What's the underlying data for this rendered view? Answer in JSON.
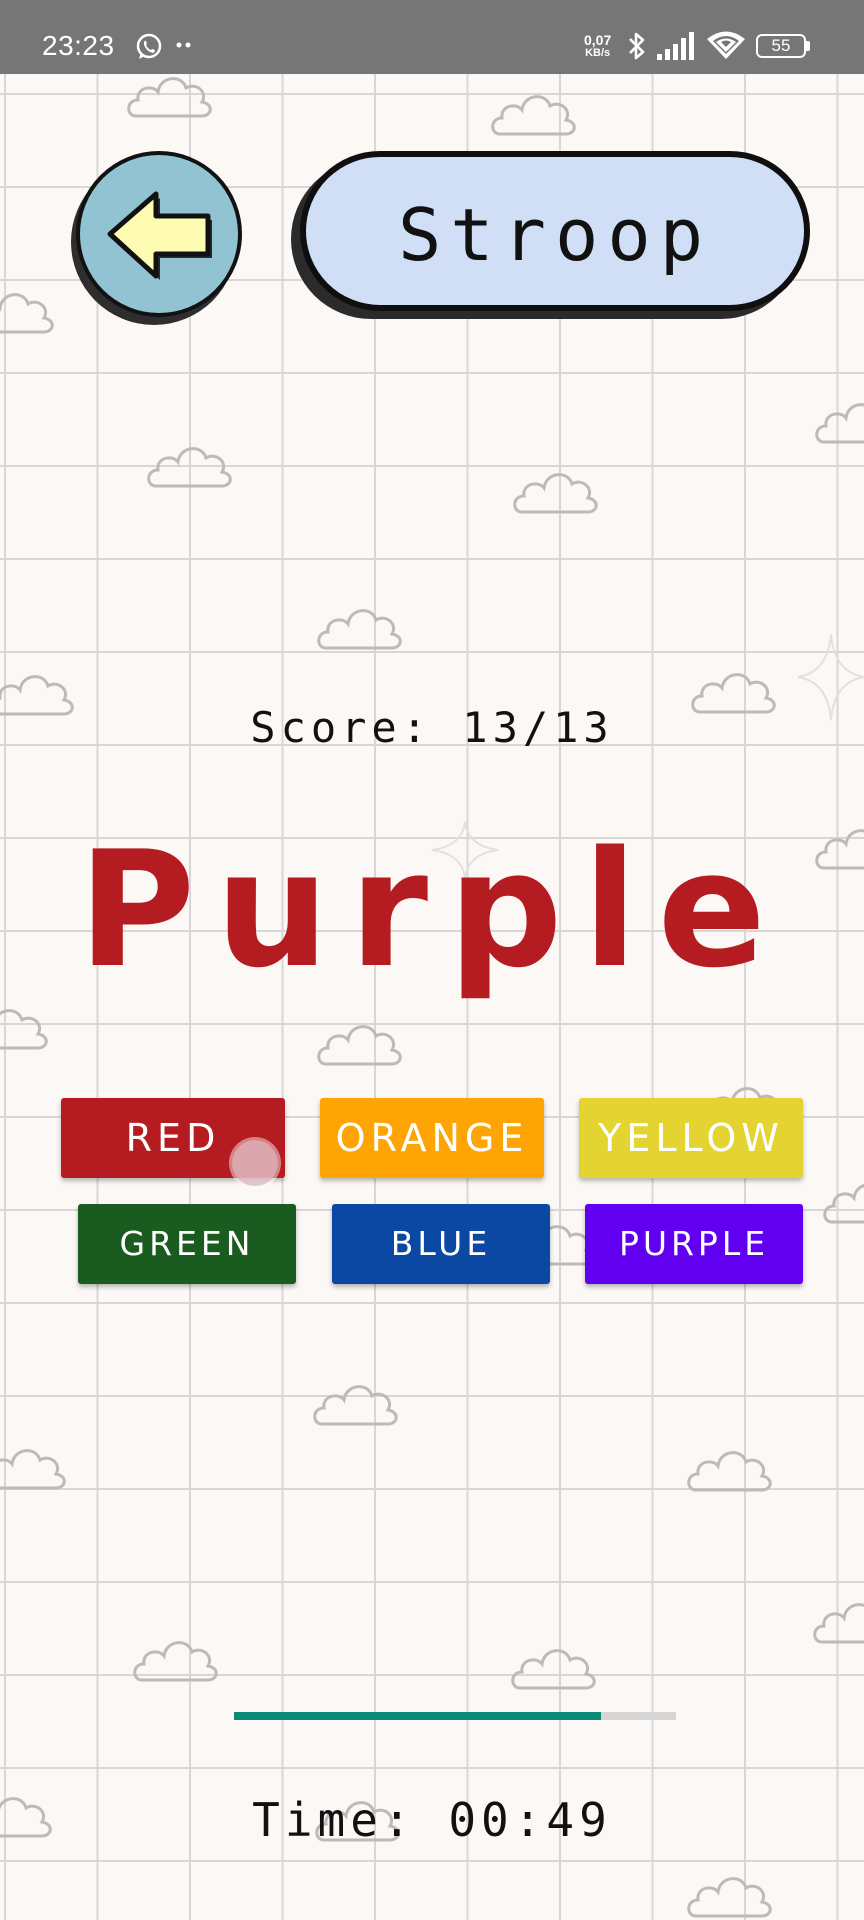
{
  "status_bar": {
    "time": "23:23",
    "network_speed_value": "0,07",
    "network_speed_unit": "KB/s",
    "battery": "55",
    "icons": [
      "whatsapp-icon",
      "more-dots-icon",
      "bluetooth-icon",
      "signal-icon",
      "wifi-icon",
      "battery-icon"
    ]
  },
  "header": {
    "back_icon": "arrow-left-icon",
    "title": "Stroop"
  },
  "game": {
    "score_label": "Score: 13/13",
    "stimulus_word": "Purple",
    "stimulus_color": "#b51c21",
    "options": [
      {
        "label": "RED",
        "color": "#b51c21"
      },
      {
        "label": "ORANGE",
        "color": "#fea404"
      },
      {
        "label": "YELLOW",
        "color": "#e3d432"
      },
      {
        "label": "GREEN",
        "color": "#1a5c20"
      },
      {
        "label": "BLUE",
        "color": "#0b48a3"
      },
      {
        "label": "PURPLE",
        "color": "#6100f0"
      }
    ]
  },
  "timer": {
    "progress": 0.83,
    "progress_color": "#0c8a78",
    "time_label": "Time: 00:49"
  }
}
